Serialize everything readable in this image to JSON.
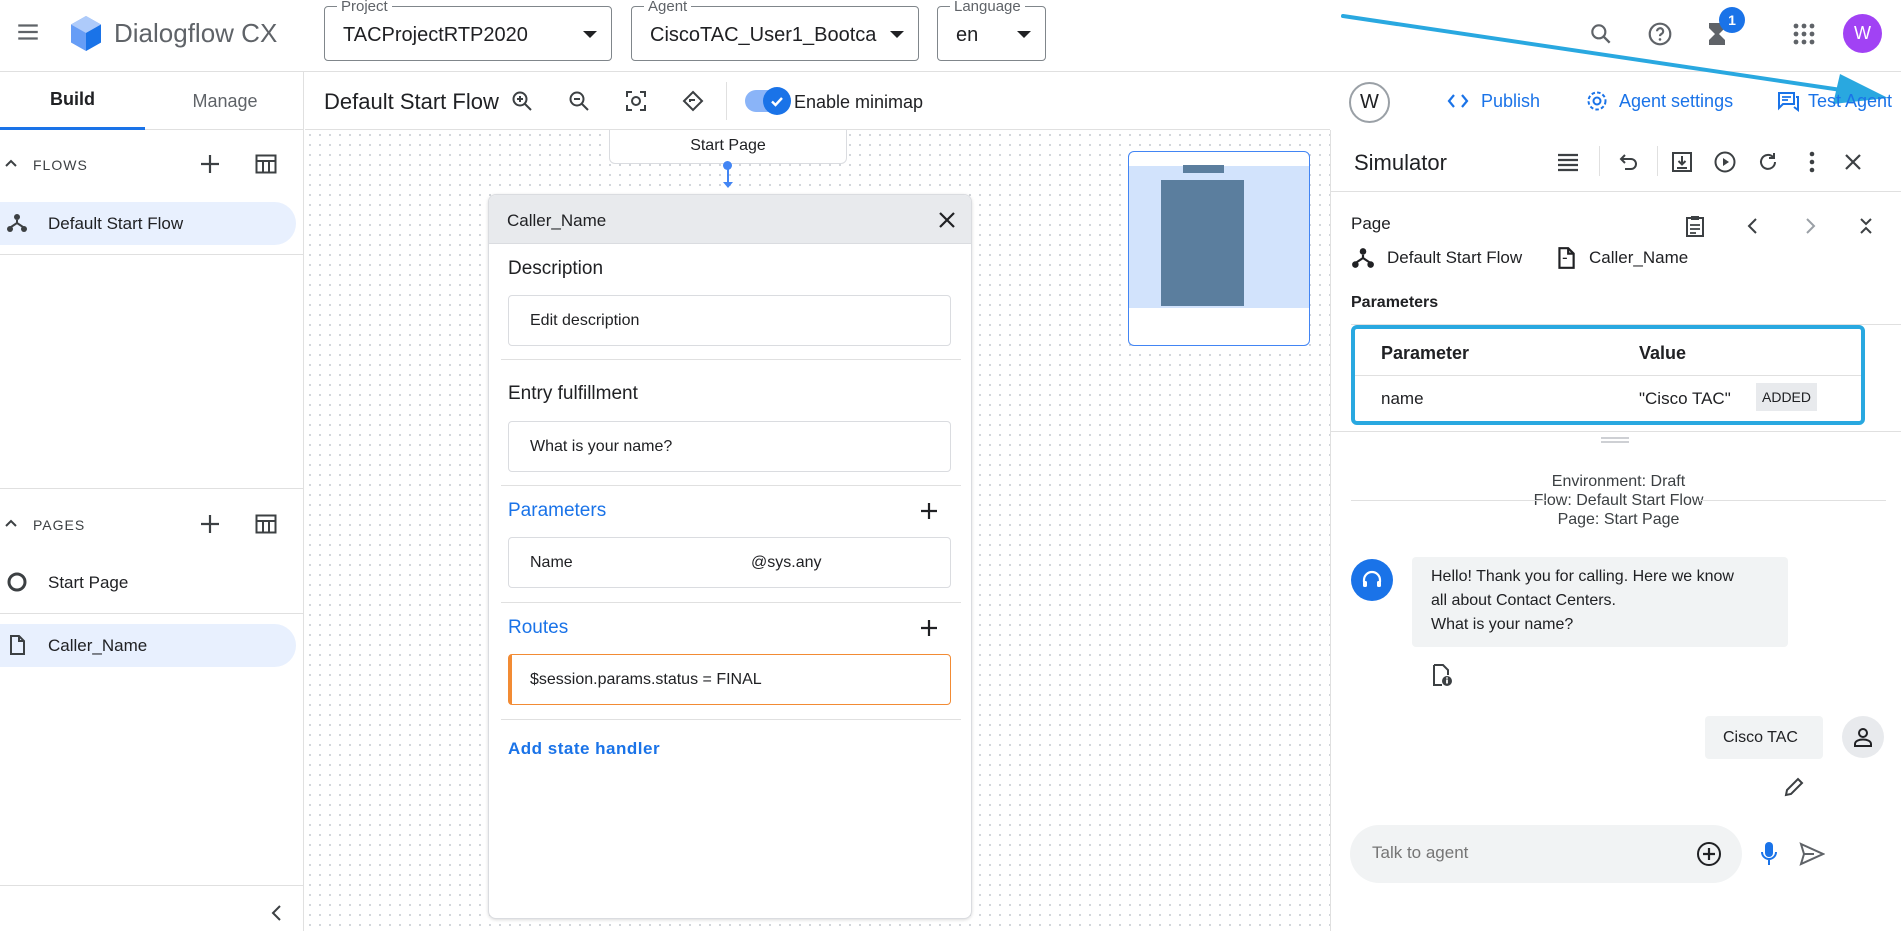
{
  "app": {
    "title": "Dialogflow CX"
  },
  "header": {
    "project": {
      "label": "Project",
      "value": "TACProjectRTP2020"
    },
    "agent": {
      "label": "Agent",
      "value": "CiscoTAC_User1_Bootca..."
    },
    "language": {
      "label": "Language",
      "value": "en"
    },
    "notification_count": "1",
    "user_initial": "W"
  },
  "nav": {
    "tabs": [
      "Build",
      "Manage"
    ],
    "flows_title": "FLOWS",
    "flows": [
      "Default Start Flow"
    ],
    "pages_title": "PAGES",
    "pages": [
      "Start Page",
      "Caller_Name"
    ]
  },
  "canvas": {
    "flow_title": "Default Start Flow",
    "minimap_label": "Enable minimap",
    "start_node": "Start Page",
    "page_card": {
      "title": "Caller_Name",
      "description_title": "Description",
      "description_value": "Edit description",
      "entry_title": "Entry fulfillment",
      "entry_value": "What is your name?",
      "parameters_title": "Parameters",
      "param_name": "Name",
      "param_entity": "@sys.any",
      "routes_title": "Routes",
      "route_condition": "$session.params.status = FINAL",
      "add_handler": "Add state handler"
    }
  },
  "actions": {
    "collaborator_initial": "W",
    "publish": "Publish",
    "agent_settings": "Agent settings",
    "test_agent": "Test Agent"
  },
  "simulator": {
    "title": "Simulator",
    "page_label": "Page",
    "flow": "Default Start Flow",
    "separator": "-",
    "page": "Caller_Name",
    "parameters_label": "Parameters",
    "table_headers": [
      "Parameter",
      "Value"
    ],
    "param_row": {
      "name": "name",
      "value": "\"Cisco TAC\"",
      "status": "ADDED"
    },
    "environment": [
      "Environment: Draft",
      "Flow: Default Start Flow",
      "Page: Start Page"
    ],
    "agent_message": [
      "Hello! Thank you for calling. Here we know",
      "all about Contact Centers.",
      "What is your name?"
    ],
    "user_message": "Cisco TAC",
    "input_placeholder": "Talk to agent"
  },
  "colors": {
    "accent": "#1a73e8",
    "highlight_border": "#29a8e0",
    "route_border": "#f28b34",
    "selected_nav": "#e8f0fe",
    "user_avatar": "#a142f4"
  }
}
